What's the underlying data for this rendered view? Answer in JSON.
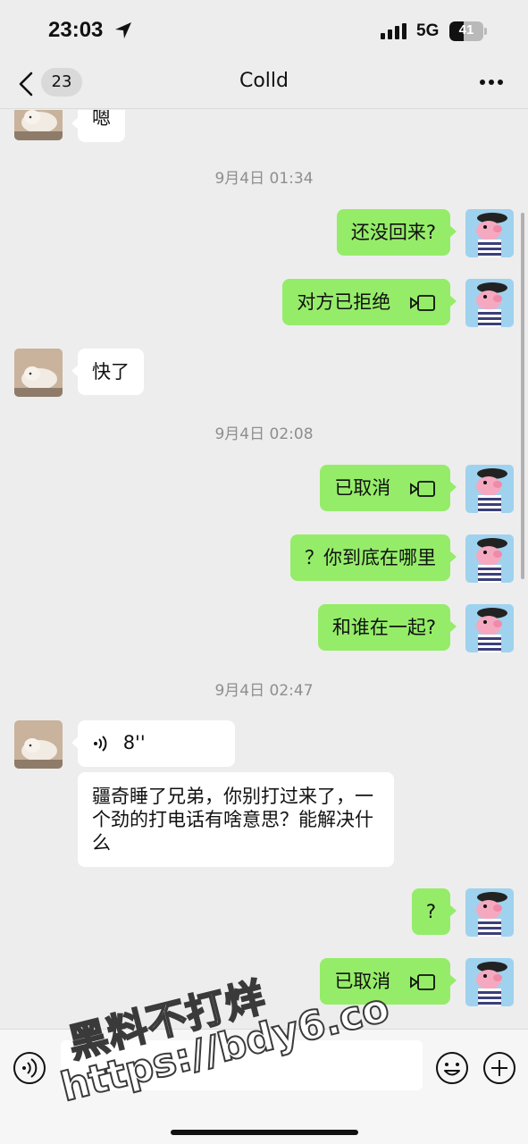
{
  "status_bar": {
    "time": "23:03",
    "network": "5G",
    "battery": "41",
    "battery_level_pct": 41
  },
  "nav": {
    "back_count": "23",
    "title": "Colld",
    "more_icon": "more-dots-icon"
  },
  "chat": {
    "messages": [
      {
        "side": "left",
        "text": "嗯"
      },
      {
        "type": "timestamp",
        "text": "9月4日 01:34"
      },
      {
        "side": "right",
        "text": "还没回来?"
      },
      {
        "side": "right",
        "text": "对方已拒绝",
        "icon": "video-call-icon"
      },
      {
        "side": "left",
        "text": "快了"
      },
      {
        "type": "timestamp",
        "text": "9月4日 02:08"
      },
      {
        "side": "right",
        "text": "已取消",
        "icon": "video-call-icon"
      },
      {
        "side": "right",
        "text": "？你到底在哪里"
      },
      {
        "side": "right",
        "text": "和谁在一起?"
      },
      {
        "type": "timestamp",
        "text": "9月4日 02:47"
      },
      {
        "side": "left",
        "text": "8''",
        "icon": "voice-wave-icon"
      },
      {
        "side": "left",
        "text": "疆奇睡了兄弟，你别打过来了，一个劲的打电话有啥意思？能解决什么"
      },
      {
        "side": "right",
        "text": "?"
      },
      {
        "side": "right",
        "text": "已取消",
        "icon": "video-call-icon"
      }
    ]
  },
  "input_bar": {
    "placeholder": "",
    "voice_icon": "voice-mode-icon",
    "emoji_icon": "emoji-icon",
    "plus_icon": "plus-icon"
  },
  "watermark": {
    "line1": "黑料不打烊",
    "line2": "https://bdy6.co"
  },
  "colors": {
    "background": "#ededed",
    "outgoing_bubble": "#95ec69",
    "incoming_bubble": "#ffffff",
    "timestamp": "#8e8e8e"
  }
}
